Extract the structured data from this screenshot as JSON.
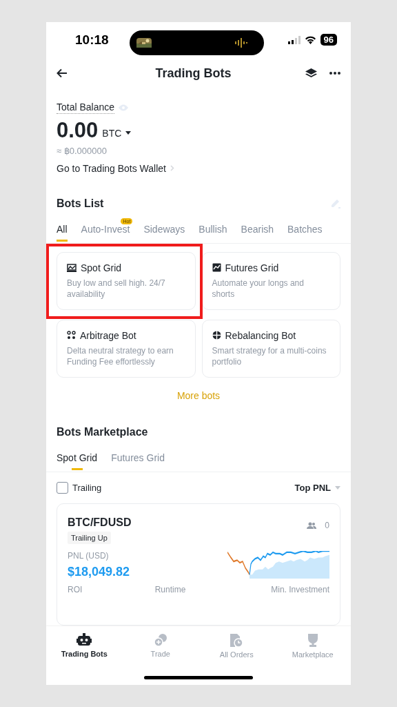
{
  "status_bar": {
    "time": "10:18",
    "battery": "96"
  },
  "header": {
    "title": "Trading Bots"
  },
  "balance": {
    "label": "Total Balance",
    "amount": "0.00",
    "currency": "BTC",
    "fiat": "≈ ฿0.000000",
    "wallet_link": "Go to Trading Bots Wallet"
  },
  "bots_list": {
    "title": "Bots List",
    "tabs": [
      {
        "label": "All",
        "selected": true
      },
      {
        "label": "Auto-Invest",
        "selected": false,
        "badge": "Hot"
      },
      {
        "label": "Sideways",
        "selected": false
      },
      {
        "label": "Bullish",
        "selected": false
      },
      {
        "label": "Bearish",
        "selected": false
      },
      {
        "label": "Batches",
        "selected": false
      }
    ],
    "bots": [
      {
        "name": "Spot Grid",
        "description": "Buy low and sell high. 24/7 availability",
        "kind": "grid",
        "highlighted": true
      },
      {
        "name": "Futures Grid",
        "description": "Automate your longs and shorts",
        "kind": "futures",
        "highlighted": false
      },
      {
        "name": "Arbitrage Bot",
        "description": "Delta neutral strategy to earn Funding Fee effortlessly",
        "kind": "arbitrage",
        "highlighted": false
      },
      {
        "name": "Rebalancing Bot",
        "description": "Smart strategy for a multi-coins portfolio",
        "kind": "rebalance",
        "highlighted": false
      }
    ],
    "more": "More bots"
  },
  "marketplace": {
    "title": "Bots Marketplace",
    "tabs": [
      {
        "label": "Spot Grid",
        "selected": true
      },
      {
        "label": "Futures Grid",
        "selected": false
      }
    ],
    "filter": {
      "label": "Trailing",
      "checked": false
    },
    "sort": "Top PNL",
    "card": {
      "pair": "BTC/FDUSD",
      "tag": "Trailing Up",
      "followers": "0",
      "pnl_label": "PNL (USD)",
      "pnl": "$18,049.82",
      "stats": [
        "ROI",
        "Runtime",
        "Min. Investment"
      ]
    }
  },
  "nav": [
    {
      "label": "Trading Bots",
      "kind": "robot",
      "selected": true
    },
    {
      "label": "Trade",
      "kind": "coins",
      "selected": false
    },
    {
      "label": "All Orders",
      "kind": "orders",
      "selected": false
    },
    {
      "label": "Marketplace",
      "kind": "trophy",
      "selected": false
    }
  ]
}
